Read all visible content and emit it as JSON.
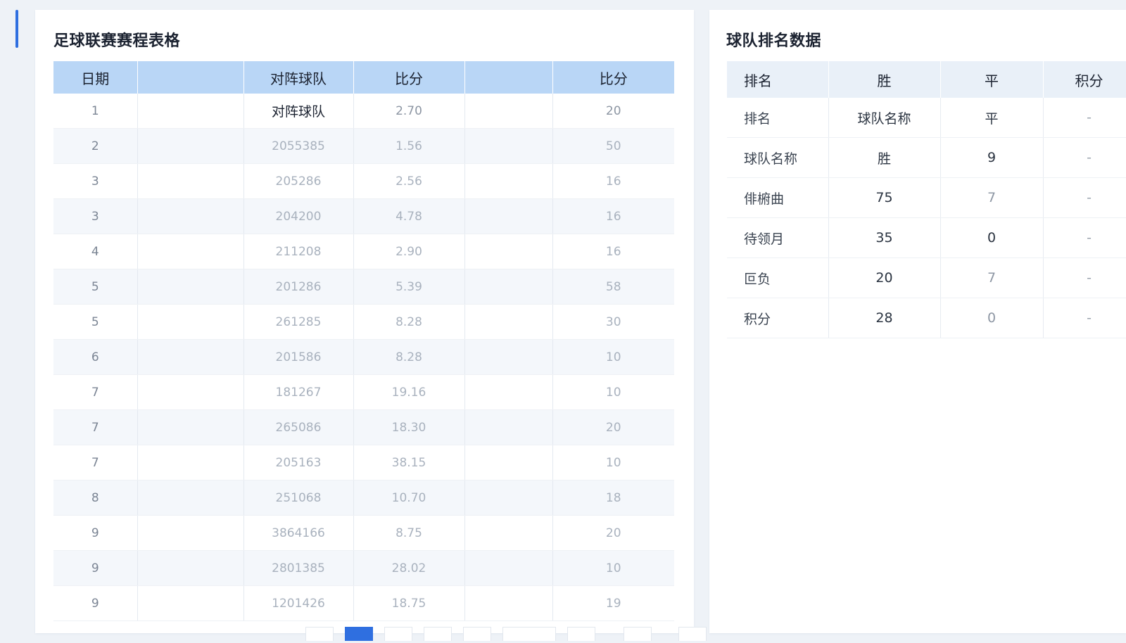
{
  "schedule": {
    "title": "足球联赛赛程表格",
    "headers": [
      "日期",
      "",
      "对阵球队",
      "比分",
      "",
      "比分"
    ],
    "rows": [
      [
        "1",
        "",
        "对阵球队",
        "2.70",
        "",
        "20"
      ],
      [
        "2",
        "",
        "2055385",
        "1.56",
        "",
        "50"
      ],
      [
        "3",
        "",
        "205286",
        "2.56",
        "",
        "16"
      ],
      [
        "3",
        "",
        "204200",
        "4.78",
        "",
        "16"
      ],
      [
        "4",
        "",
        "211208",
        "2.90",
        "",
        "16"
      ],
      [
        "5",
        "",
        "201286",
        "5.39",
        "",
        "58"
      ],
      [
        "5",
        "",
        "261285",
        "8.28",
        "",
        "30"
      ],
      [
        "6",
        "",
        "201586",
        "8.28",
        "",
        "10"
      ],
      [
        "7",
        "",
        "181267",
        "19.16",
        "",
        "10"
      ],
      [
        "7",
        "",
        "265086",
        "18.30",
        "",
        "20"
      ],
      [
        "7",
        "",
        "205163",
        "38.15",
        "",
        "10"
      ],
      [
        "8",
        "",
        "251068",
        "10.70",
        "",
        "18"
      ],
      [
        "9",
        "",
        "3864166",
        "8.75",
        "",
        "20"
      ],
      [
        "9",
        "",
        "2801385",
        "28.02",
        "",
        "10"
      ],
      [
        "9",
        "",
        "1201426",
        "18.75",
        "",
        "19"
      ]
    ]
  },
  "standings": {
    "title": "球队排名数据",
    "headers": [
      "排名",
      "胜",
      "平",
      "积分"
    ],
    "rows": [
      [
        "排名",
        "球队名称",
        "平",
        "-"
      ],
      [
        "球队名称",
        "胜",
        "9",
        "-"
      ],
      [
        "俳椨曲",
        "75",
        "7",
        "-"
      ],
      [
        "待领月",
        "35",
        "0",
        "-"
      ],
      [
        "叵负",
        "20",
        "7",
        "-"
      ],
      [
        "积分",
        "28",
        "0",
        "-"
      ]
    ]
  },
  "colors": {
    "accent": "#2f6fe0",
    "schedule_header_bg": "#b9d6f6",
    "standings_header_bg": "#e9f0f8"
  }
}
